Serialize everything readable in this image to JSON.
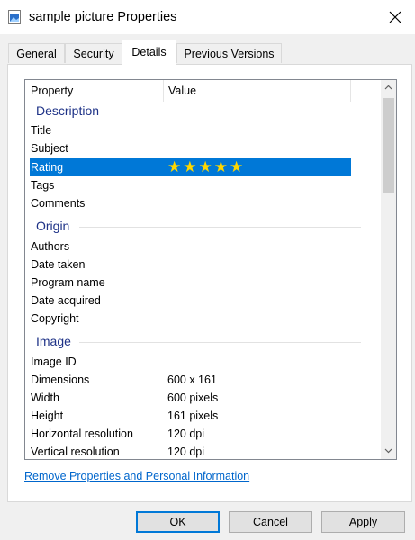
{
  "window": {
    "title": "sample picture Properties"
  },
  "tabs": [
    "General",
    "Security",
    "Details",
    "Previous Versions"
  ],
  "list": {
    "headers": {
      "property": "Property",
      "value": "Value"
    },
    "groups": {
      "description": "Description",
      "origin": "Origin",
      "image": "Image"
    },
    "description_rows": [
      {
        "k": "Title",
        "v": ""
      },
      {
        "k": "Subject",
        "v": ""
      },
      {
        "k": "Rating",
        "v": "★★★★★"
      },
      {
        "k": "Tags",
        "v": ""
      },
      {
        "k": "Comments",
        "v": ""
      }
    ],
    "rating_value": 5,
    "origin_rows": [
      {
        "k": "Authors",
        "v": ""
      },
      {
        "k": "Date taken",
        "v": ""
      },
      {
        "k": "Program name",
        "v": ""
      },
      {
        "k": "Date acquired",
        "v": ""
      },
      {
        "k": "Copyright",
        "v": ""
      }
    ],
    "image_rows": [
      {
        "k": "Image ID",
        "v": ""
      },
      {
        "k": "Dimensions",
        "v": "600 x 161"
      },
      {
        "k": "Width",
        "v": "600 pixels"
      },
      {
        "k": "Height",
        "v": "161 pixels"
      },
      {
        "k": "Horizontal resolution",
        "v": "120 dpi"
      },
      {
        "k": "Vertical resolution",
        "v": "120 dpi"
      }
    ]
  },
  "link": "Remove Properties and Personal Information",
  "buttons": {
    "ok": "OK",
    "cancel": "Cancel",
    "apply": "Apply"
  },
  "colors": {
    "selection": "#0078d7",
    "group_title": "#1e3287",
    "link": "#0066cc",
    "star": "#ffd700"
  }
}
